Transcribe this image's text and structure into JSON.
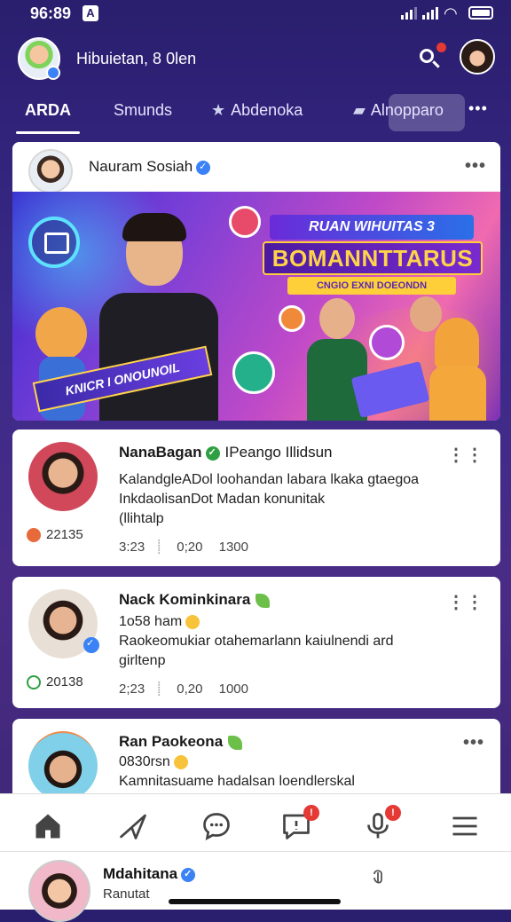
{
  "status": {
    "time": "96:89"
  },
  "header": {
    "title": "Hibuietan, 8 0len"
  },
  "tabs": [
    {
      "label": "ARDA"
    },
    {
      "label": "Smunds"
    },
    {
      "label": "Abdenoka"
    },
    {
      "label": "Alnopparo"
    }
  ],
  "feature": {
    "author": "Nauram Sosiah",
    "banner": {
      "line1": "RUAN WIHUITAS 3",
      "line2": "BOMANNTTARUS",
      "line3": "CNGIO EXNI DOEONDN",
      "ribbon": "KNICR I ONOUNOIL"
    }
  },
  "posts": [
    {
      "name": "NanaBagan",
      "sub": "IPeango Illidsun",
      "text_lines": [
        "KalandgleADol loohandan labara lkaka gtaegoa",
        "InkdaolisanDot Madan konunitak",
        "(llihtalp"
      ],
      "meta": [
        "3:23",
        "0;20",
        "1300"
      ],
      "count": "22135"
    },
    {
      "name": "Nack Kominkinara",
      "sub": "1o58 ham",
      "text_lines": [
        "Raokeomukiar otahemarlann kaiulnendi ard",
        "girltenp"
      ],
      "meta": [
        "2;23",
        "0,20",
        "1000"
      ],
      "count": "20138"
    },
    {
      "name": "Ran Paokeona",
      "sub": "0830rsn",
      "text_lines": [
        "Kamnitasuame hadalsan loendlerskal"
      ],
      "meta": [],
      "count": ""
    }
  ],
  "me": {
    "name": "Mdahitana",
    "sub": "Ranutat"
  },
  "colors": {
    "accent": "#3b82f6",
    "badge": "#e53935",
    "background_top": "#2a1e6e"
  },
  "icons": [
    "search-icon",
    "home-icon",
    "send-icon",
    "chat-icon",
    "message-icon",
    "mic-icon",
    "menu-icon"
  ]
}
